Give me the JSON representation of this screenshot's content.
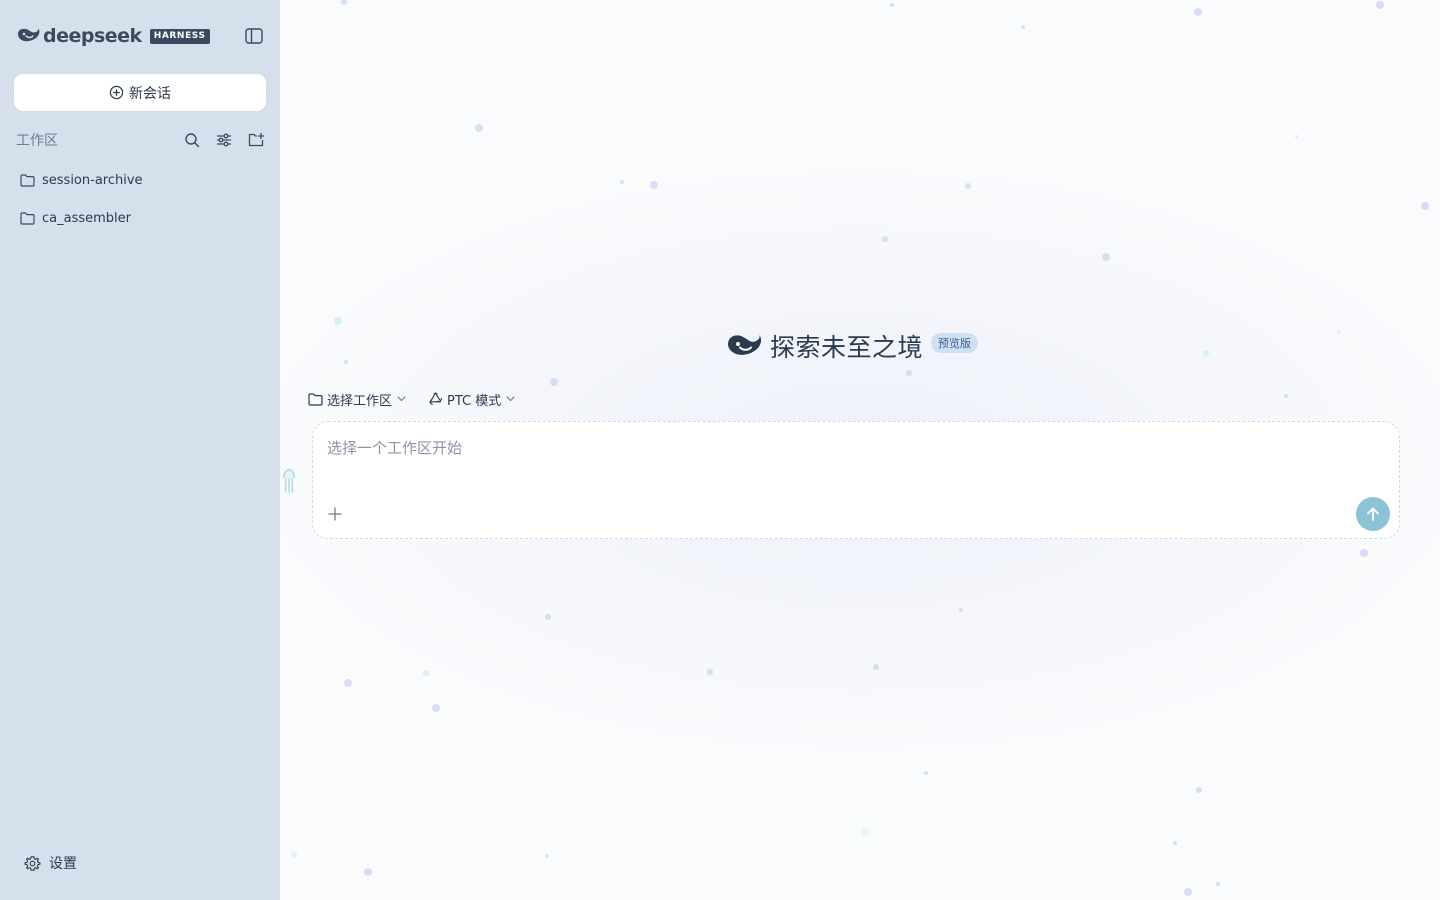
{
  "sidebar": {
    "brand": {
      "wordmark": "deepseek",
      "tag": "HARNESS"
    },
    "new_chat_label": "新会话",
    "workspace": {
      "title": "工作区",
      "items": [
        {
          "label": "session-archive"
        },
        {
          "label": "ca_assembler"
        }
      ]
    },
    "settings_label": "设置"
  },
  "main": {
    "hero": {
      "title": "探索未至之境",
      "badge": "预览版"
    },
    "toolbar": {
      "workspace_select_label": "选择工作区",
      "mode_select_label": "PTC 模式"
    },
    "composer": {
      "placeholder": "选择一个工作区开始"
    }
  },
  "colors": {
    "sidebar_bg": "#d6e0ec",
    "text": "#2c3a4d",
    "muted": "#6f7d90",
    "accent_send": "#8ec3d6",
    "badge_bg": "#cfe0f3"
  },
  "icons": {
    "brand": "whale-logo-icon",
    "collapse": "sidebar-toggle-icon",
    "new_chat": "plus-circle-icon",
    "search": "search-icon",
    "filter": "sliders-icon",
    "add_folder": "folder-plus-icon",
    "folder": "folder-icon",
    "settings": "gear-icon",
    "mode": "recycle-icon",
    "chevron": "chevron-down-icon",
    "attach": "plus-icon",
    "send": "arrow-up-icon"
  }
}
